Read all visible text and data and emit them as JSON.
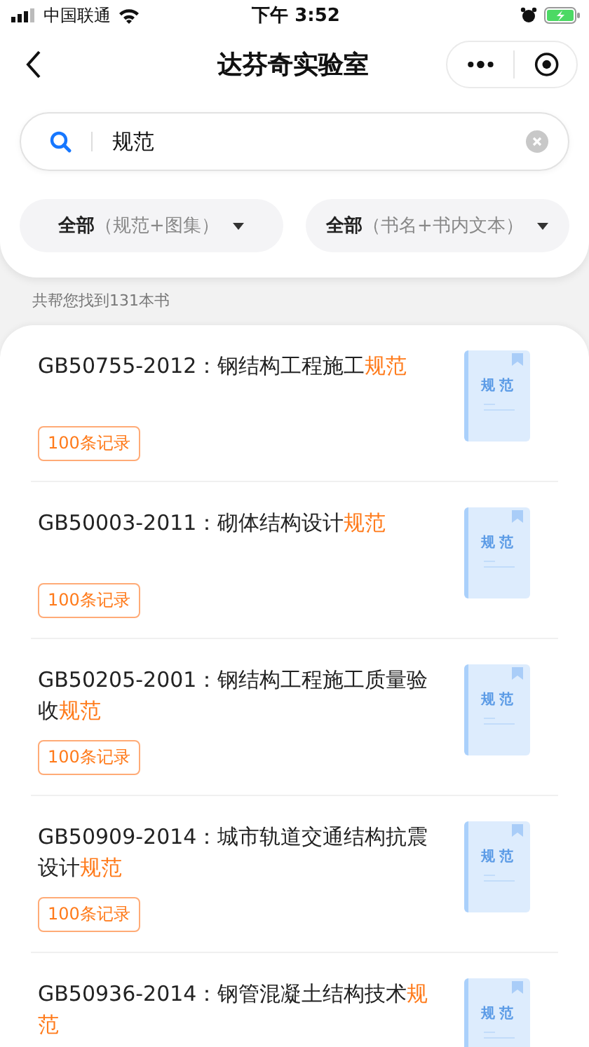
{
  "status_bar": {
    "carrier": "中国联通",
    "time": "下午 3:52"
  },
  "nav": {
    "title": "达芬奇实验室"
  },
  "search": {
    "value": "规范"
  },
  "filters": [
    {
      "label": "全部",
      "hint": "（规范+图集）"
    },
    {
      "label": "全部",
      "hint": "（书名+书内文本）"
    }
  ],
  "result_count": "共帮您找到131本书",
  "books": [
    {
      "title": "GB50755-2012：钢结构工程施工",
      "highlight": "规范",
      "badge": "100条记录",
      "cover_label": "规范"
    },
    {
      "title": "GB50003-2011：砌体结构设计",
      "highlight": "规范",
      "badge": "100条记录",
      "cover_label": "规范"
    },
    {
      "title": "GB50205-2001：钢结构工程施工质量验收",
      "highlight": "规范",
      "badge": "100条记录",
      "cover_label": "规范"
    },
    {
      "title": "GB50909-2014：城市轨道交通结构抗震设计",
      "highlight": "规范",
      "badge": "100条记录",
      "cover_label": "规范"
    },
    {
      "title": "GB50936-2014：钢管混凝土结构技术",
      "highlight": "规范",
      "cover_label": "规范"
    }
  ]
}
